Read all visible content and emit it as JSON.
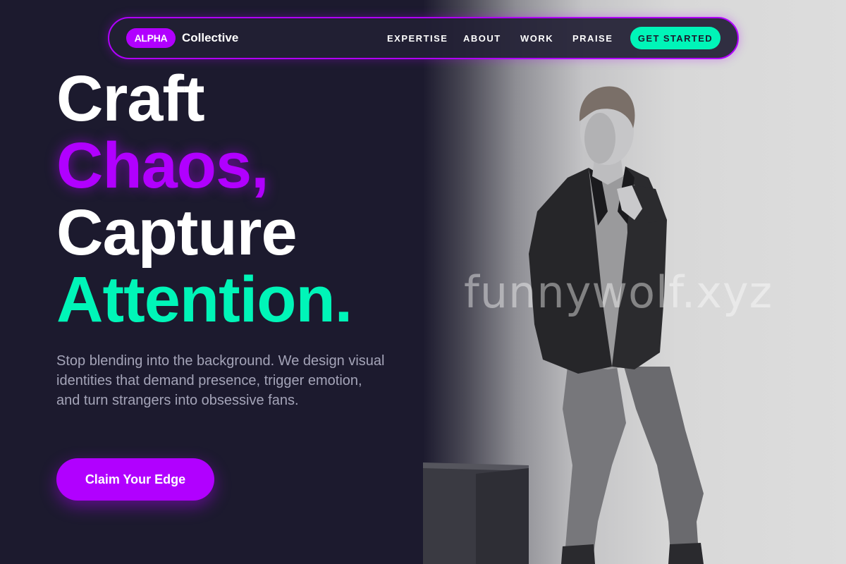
{
  "brand": {
    "badge": "ALPHA",
    "name": "Collective"
  },
  "nav": {
    "links": [
      "EXPERTISE",
      "ABOUT",
      "WORK",
      "PRAISE"
    ],
    "cta": "GET STARTED"
  },
  "hero": {
    "line1": "Craft",
    "line2": "Chaos,",
    "line3": "Capture",
    "line4": "Attention.",
    "subcopy": "Stop blending into the background. We design visual identities that demand presence, trigger emotion, and turn strangers into obsessive fans.",
    "cta": "Claim Your Edge"
  },
  "photo": {
    "watermark": "funnywolf.xyz",
    "subject": "man-in-blazer-photo"
  },
  "colors": {
    "background": "#1c1a2e",
    "purple_accent": "#b100ff",
    "green_accent": "#00f5b8",
    "muted_text": "#a4a4b8"
  }
}
